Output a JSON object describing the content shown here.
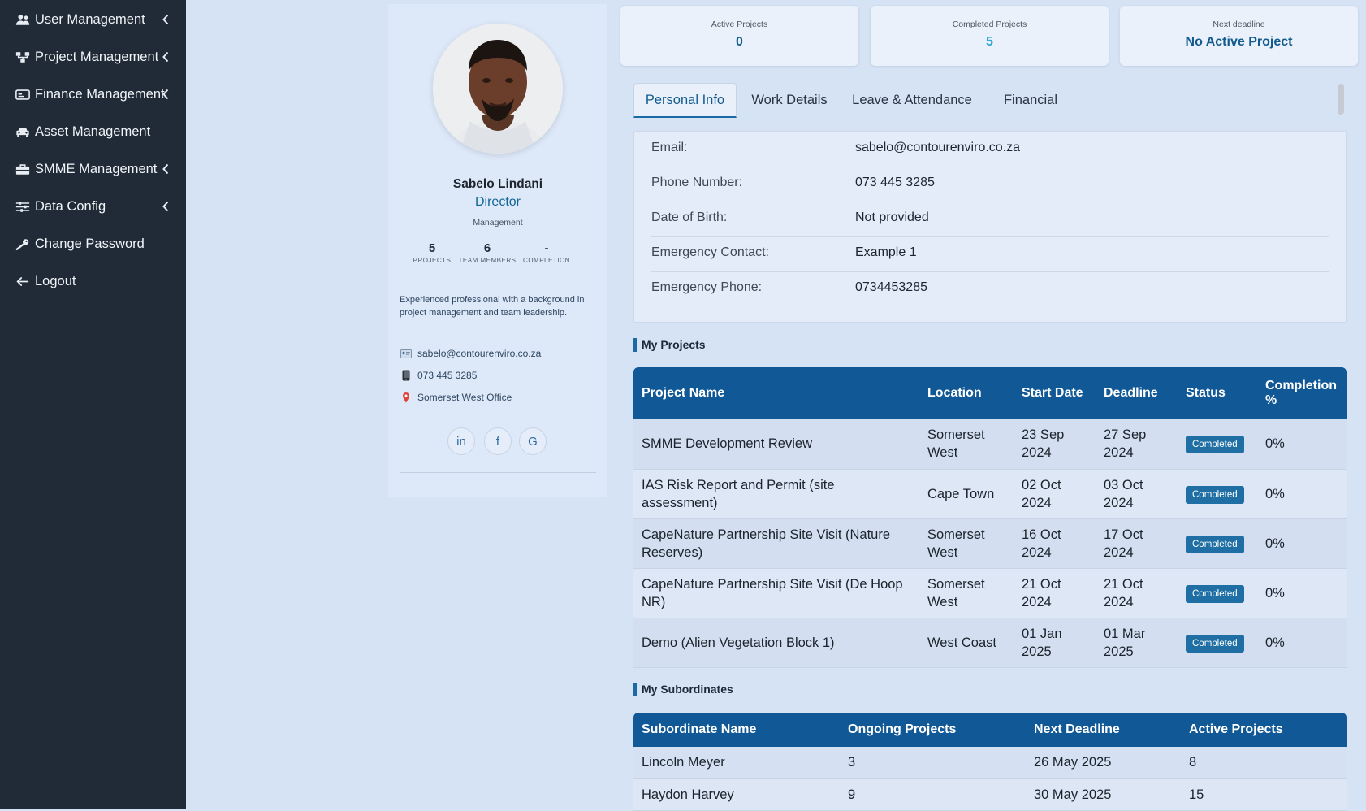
{
  "sidebar": {
    "items": [
      {
        "label": "User Management",
        "icon": "users-icon",
        "has_chevron": true
      },
      {
        "label": "Project Management",
        "icon": "sitemap-icon",
        "has_chevron": true
      },
      {
        "label": "Finance Management",
        "icon": "money-card-icon",
        "has_chevron": true
      },
      {
        "label": "Asset Management",
        "icon": "car-icon",
        "has_chevron": false
      },
      {
        "label": "SMME Management",
        "icon": "briefcase-icon",
        "has_chevron": true
      },
      {
        "label": "Data Config",
        "icon": "sliders-icon",
        "has_chevron": true
      },
      {
        "label": "Change Password",
        "icon": "key-icon",
        "has_chevron": false
      },
      {
        "label": "Logout",
        "icon": "arrow-left-icon",
        "has_chevron": false
      }
    ]
  },
  "profile": {
    "name": "Sabelo Lindani",
    "role": "Director",
    "department": "Management",
    "stats": [
      {
        "value": "5",
        "label": "PROJECTS"
      },
      {
        "value": "6",
        "label": "TEAM MEMBERS"
      },
      {
        "value": "-",
        "label": "COMPLETION"
      }
    ],
    "bio": "Experienced professional with a background in project management and team leadership.",
    "email": "sabelo@contourenviro.co.za",
    "phone": "073 445 3285",
    "office": "Somerset West Office",
    "social": [
      "in",
      "f",
      "G"
    ]
  },
  "summary": {
    "active_projects_label": "Active Projects",
    "active_projects_value": "0",
    "completed_projects_label": "Completed Projects",
    "completed_projects_value": "5",
    "next_deadline_label": "Next deadline",
    "next_deadline_value": "No Active Project"
  },
  "tabs": [
    {
      "label": "Personal Info",
      "active": true
    },
    {
      "label": "Work Details",
      "active": false
    },
    {
      "label": "Leave & Attendance",
      "active": false
    },
    {
      "label": "Financial",
      "active": false
    }
  ],
  "personal_info": [
    {
      "key": "Email:",
      "value": "sabelo@contourenviro.co.za"
    },
    {
      "key": "Phone Number:",
      "value": "073 445 3285"
    },
    {
      "key": "Date of Birth:",
      "value": "Not provided"
    },
    {
      "key": "Emergency Contact:",
      "value": "Example 1"
    },
    {
      "key": "Emergency Phone:",
      "value": "0734453285"
    }
  ],
  "my_projects": {
    "title": "My Projects",
    "columns": [
      "Project Name",
      "Location",
      "Start Date",
      "Deadline",
      "Status",
      "Completion %"
    ],
    "rows": [
      {
        "name": "SMME Development Review",
        "location": "Somerset West",
        "start": "23 Sep 2024",
        "deadline": "27 Sep 2024",
        "status": "Completed",
        "completion": "0%"
      },
      {
        "name": "IAS Risk Report and Permit (site assessment)",
        "location": "Cape Town",
        "start": "02 Oct 2024",
        "deadline": "03 Oct 2024",
        "status": "Completed",
        "completion": "0%"
      },
      {
        "name": "CapeNature Partnership Site Visit (Nature Reserves)",
        "location": "Somerset West",
        "start": "16 Oct 2024",
        "deadline": "17 Oct 2024",
        "status": "Completed",
        "completion": "0%"
      },
      {
        "name": "CapeNature Partnership Site Visit (De Hoop NR)",
        "location": "Somerset West",
        "start": "21 Oct 2024",
        "deadline": "21 Oct 2024",
        "status": "Completed",
        "completion": "0%"
      },
      {
        "name": "Demo (Alien Vegetation Block 1)",
        "location": "West Coast",
        "start": "01 Jan 2025",
        "deadline": "01 Mar 2025",
        "status": "Completed",
        "completion": "0%"
      }
    ]
  },
  "my_subordinates": {
    "title": "My Subordinates",
    "columns": [
      "Subordinate Name",
      "Ongoing Projects",
      "Next Deadline",
      "Active Projects"
    ],
    "rows": [
      {
        "name": "Lincoln Meyer",
        "ongoing": "3",
        "next_deadline": "26 May 2025",
        "active": "8"
      },
      {
        "name": "Haydon Harvey",
        "ongoing": "9",
        "next_deadline": "30 May 2025",
        "active": "15"
      }
    ]
  },
  "colors": {
    "sidebar_bg": "#202b37",
    "page_bg": "#d6e3f5",
    "accent": "#115896",
    "completed_value": "#2fa4d8",
    "active_value": "#135b8f",
    "badge": "#1f6fa4"
  }
}
